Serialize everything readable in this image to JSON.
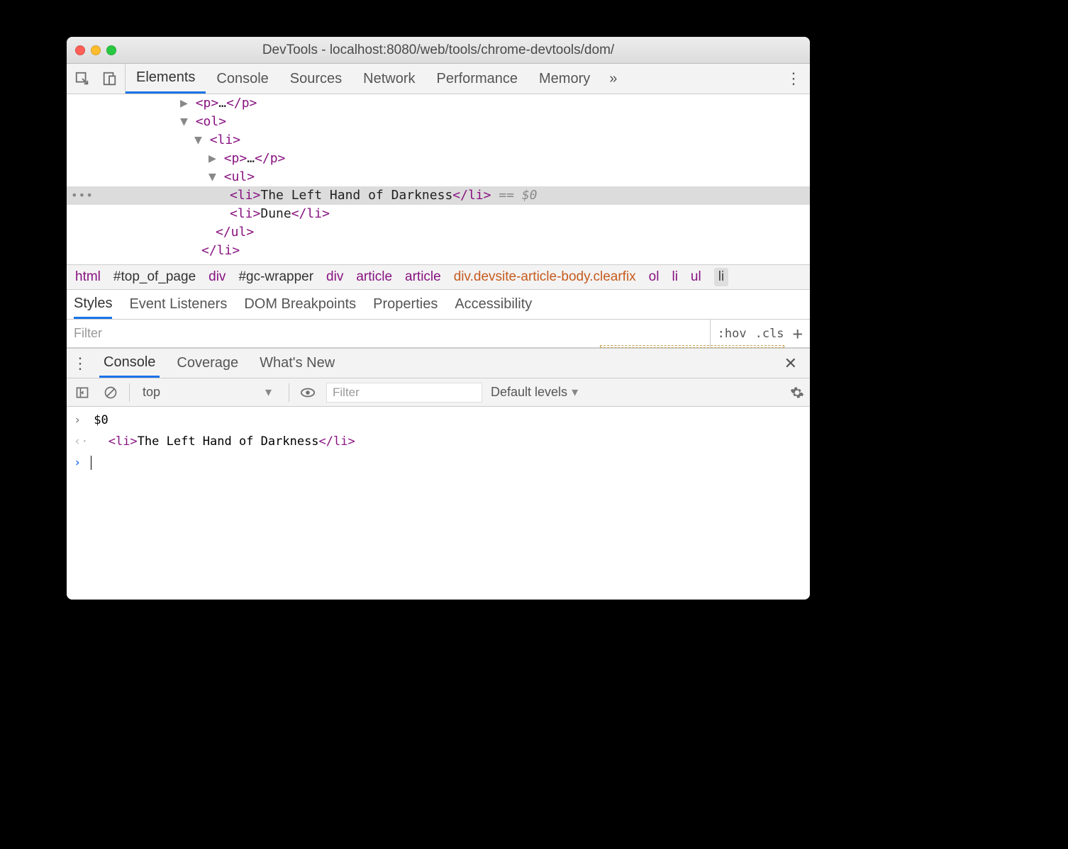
{
  "window": {
    "title": "DevTools - localhost:8080/web/tools/chrome-devtools/dom/"
  },
  "mainTabs": [
    "Elements",
    "Console",
    "Sources",
    "Network",
    "Performance",
    "Memory"
  ],
  "mainTabsActive": "Elements",
  "dom": {
    "lines": [
      {
        "indent": 160,
        "arrow": "▶",
        "open": "<p>",
        "mid": "…",
        "close": "</p>"
      },
      {
        "indent": 160,
        "arrow": "▼",
        "open": "<ol>"
      },
      {
        "indent": 180,
        "arrow": "▼",
        "open": "<li>"
      },
      {
        "indent": 200,
        "arrow": "▶",
        "open": "<p>",
        "mid": "…",
        "close": "</p>"
      },
      {
        "indent": 200,
        "arrow": "▼",
        "open": "<ul>"
      },
      {
        "indent": 230,
        "open": "<li>",
        "text": "The Left Hand of Darkness",
        "close": "</li>",
        "selected": true,
        "after": " == $0"
      },
      {
        "indent": 230,
        "open": "<li>",
        "text": "Dune",
        "close": "</li>"
      },
      {
        "indent": 210,
        "open": "</ul>"
      },
      {
        "indent": 190,
        "open": "</li>"
      }
    ]
  },
  "breadcrumbs": [
    {
      "label": "html",
      "type": "tag"
    },
    {
      "label": "#top_of_page",
      "type": "id"
    },
    {
      "label": "div",
      "type": "tag"
    },
    {
      "label": "#gc-wrapper",
      "type": "id"
    },
    {
      "label": "div",
      "type": "tag"
    },
    {
      "label": "article",
      "type": "tag"
    },
    {
      "label": "article",
      "type": "tag"
    },
    {
      "label": "div.devsite-article-body.clearfix",
      "type": "cls"
    },
    {
      "label": "ol",
      "type": "tag"
    },
    {
      "label": "li",
      "type": "tag"
    },
    {
      "label": "ul",
      "type": "tag"
    },
    {
      "label": "li",
      "type": "sel"
    }
  ],
  "stylesTabs": [
    "Styles",
    "Event Listeners",
    "DOM Breakpoints",
    "Properties",
    "Accessibility"
  ],
  "stylesTabsActive": "Styles",
  "filter": {
    "placeholder": "Filter",
    "hov": ":hov",
    "cls": ".cls"
  },
  "drawerTabs": [
    "Console",
    "Coverage",
    "What's New"
  ],
  "drawerTabsActive": "Console",
  "consoleToolbar": {
    "context": "top",
    "filterPlaceholder": "Filter",
    "levels": "Default levels"
  },
  "consoleLines": {
    "input": "$0",
    "outputOpen": "<li>",
    "outputText": "The Left Hand of Darkness",
    "outputClose": "</li>"
  }
}
